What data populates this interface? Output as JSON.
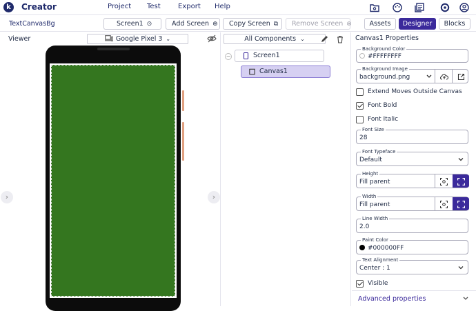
{
  "app": {
    "logo_letter": "k",
    "name": "Creator"
  },
  "menu": [
    "Project",
    "Test",
    "Export",
    "Help"
  ],
  "toolbar": {
    "project_name": "TextCanvasBg",
    "screen_select": "Screen1",
    "add_screen": "Add Screen",
    "copy_screen": "Copy Screen",
    "remove_screen": "Remove Screen",
    "assets": "Assets",
    "designer": "Designer",
    "blocks": "Blocks"
  },
  "viewer": {
    "label": "Viewer",
    "device": "Google Pixel 3"
  },
  "tree": {
    "filter": "All Components",
    "nodes": [
      {
        "label": "Screen1"
      },
      {
        "label": "Canvas1"
      }
    ]
  },
  "props": {
    "title": "Canvas1 Properties",
    "background_color": {
      "label": "Background Color",
      "value": "#FFFFFFFF"
    },
    "background_image": {
      "label": "Background Image",
      "value": "background.png"
    },
    "extend_moves": {
      "label": "Extend Moves Outside Canvas",
      "checked": false
    },
    "font_bold": {
      "label": "Font Bold",
      "checked": true
    },
    "font_italic": {
      "label": "Font Italic",
      "checked": false
    },
    "font_size": {
      "label": "Font Size",
      "value": "28"
    },
    "font_typeface": {
      "label": "Font Typeface",
      "value": "Default"
    },
    "height": {
      "label": "Height",
      "value": "Fill parent"
    },
    "width": {
      "label": "Width",
      "value": "Fill parent"
    },
    "line_width": {
      "label": "Line Width",
      "value": "2.0"
    },
    "paint_color": {
      "label": "Paint Color",
      "value": "#000000FF"
    },
    "text_alignment": {
      "label": "Text Alignment",
      "value": "Center : 1"
    },
    "visible": {
      "label": "Visible",
      "checked": true
    },
    "advanced": "Advanced properties"
  },
  "colors": {
    "accent": "#3b2a9b",
    "canvas": "#34761f",
    "brand": "#1f2a6b"
  }
}
